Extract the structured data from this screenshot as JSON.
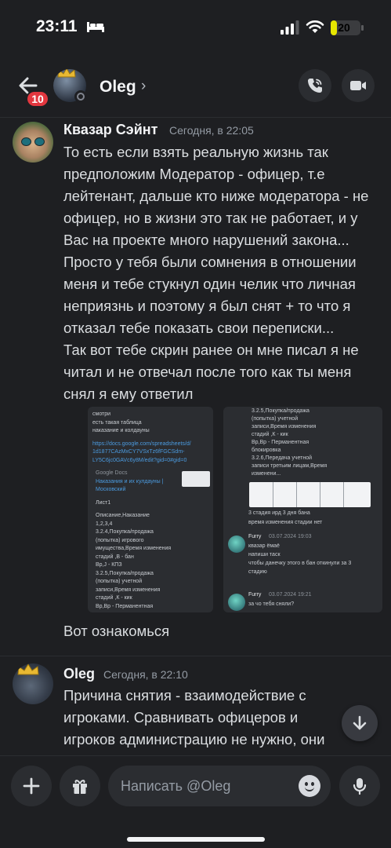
{
  "status_bar": {
    "time": "23:11",
    "battery": "20",
    "battery_level": 0.2
  },
  "header": {
    "unread_badge": "10",
    "name": "Oleg",
    "chevron": "›",
    "icons": [
      "back-arrow-icon",
      "phone-call-icon",
      "video-call-icon"
    ]
  },
  "messages": [
    {
      "author": "Квазар Сэйнт",
      "timestamp": "Сегодня, в 22:05",
      "paragraphs": [
        "То есть если взять реальную жизнь так предположим Модератор - офицер, т.е лейтенант, дальше кто ниже модератора - не офицер, но в жизни это так не работает, и у Вас на проекте много нарушений закона...",
        "Просто у тебя были сомнения в отношении меня и тебе стукнул один челик что личная неприязнь и поэтому я был снят + то что я отказал тебе показать свои переписки...",
        "Так вот тебе скрин ранее он мне писал я не читал и не отвечал после того как ты меня снял я ему ответил"
      ],
      "attachments": {
        "left": {
          "lines": [
            "смотри",
            "есть такая таблица",
            "наказание и колдауны",
            "https://docs.google.com/spreadsheets/d/",
            "1d1877CAzMxCY7VSxTz6fFGCSdm-",
            "LY5C6jc0GAVc6y8M/edit?gid=0#gid=0",
            "Google Docs",
            "Наказания и их кулдауны |",
            "Московский",
            "Лист1",
            "Описание,Наказание",
            "1,2,3,4",
            "3.2.4,Покупка/продажа",
            "(попытка) игрового",
            "имущества,Время изменения",
            "стадий ,В - бан",
            "Вр,J - КПЗ",
            "3.2.5,Покупка/продажа",
            "(попытка) учетной",
            "записи,Время изменения",
            "стадий ,К - кик",
            "Вр,Вр - Перманентная"
          ]
        },
        "right": {
          "top_lines": [
            "3.2.5,Покупка/продажа",
            "(попытка) учетной",
            "записи,Время изменения",
            "стадий ,К - кик",
            "Вр,Вр - Перманентная",
            "блокировка",
            "3.2.6,Передача учетной",
            "записи третьим лицам,Время",
            "изменени..."
          ],
          "caption_lines": [
            "3 стадия ирд 3 дня бана",
            "время изменения стадии нет"
          ],
          "replies": [
            {
              "author": "Furry",
              "time": "03.07.2024 19:03",
              "lines": [
                "квазар ёмаё",
                "напиши таск",
                "чтобы данечку этого в бан откинули за 3",
                "стадию"
              ]
            },
            {
              "author": "Furry",
              "time": "03.07.2024 19:21",
              "lines": [
                "за чо тебя сняли?"
              ]
            }
          ]
        }
      },
      "followup": "Вот ознакомься"
    },
    {
      "author": "Oleg",
      "timestamp": "Сегодня, в 22:10",
      "paragraphs": [
        "Причина снятия - взаимодействие с игроками. Сравнивать офицеров и игроков администрацию не нужно, они работают по разным правилам"
      ]
    }
  ],
  "composer": {
    "placeholder": "Написать @Oleg",
    "icons": [
      "plus-icon",
      "gift-icon",
      "emoji-icon",
      "microphone-icon"
    ]
  },
  "colors": {
    "background": "#1e1f22",
    "surface": "#2b2d31",
    "badge": "#e3373f",
    "link": "#3b7fc9"
  }
}
